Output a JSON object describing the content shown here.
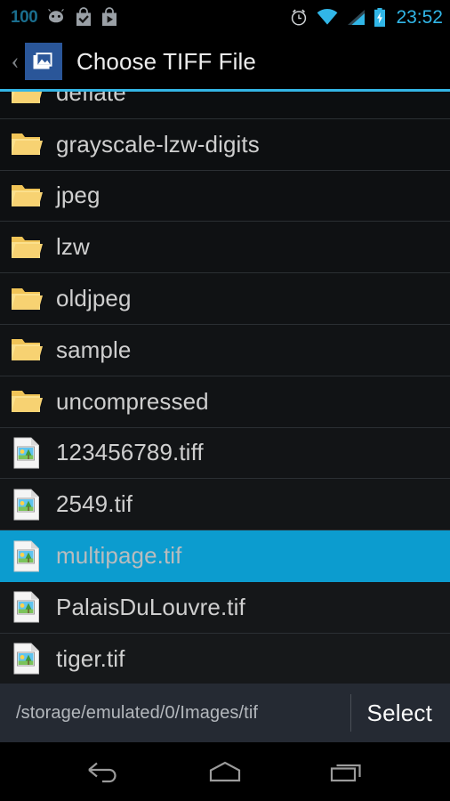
{
  "status_bar": {
    "battery_percent": "100",
    "battery_color": "#1a6e8e",
    "clock": "23:52",
    "clock_color": "#31b6e7",
    "left_icons": [
      "android-head-icon",
      "app-checked-icon",
      "play-store-icon"
    ],
    "right_icons": [
      "alarm-clock-icon",
      "wifi-icon",
      "cellular-signal-icon",
      "battery-charging-icon"
    ]
  },
  "title_bar": {
    "back_label": "‹",
    "app_icon": "gallery-image-icon",
    "app_icon_bg": "#2a5699",
    "title": "Choose TIFF File",
    "accent_rule_color": "#33b5e5"
  },
  "file_list": {
    "selected_index": 9,
    "rows": [
      {
        "name": "deflate",
        "type": "folder",
        "selected": false,
        "clipped": true
      },
      {
        "name": "grayscale-lzw-digits",
        "type": "folder",
        "selected": false,
        "clipped": false
      },
      {
        "name": "jpeg",
        "type": "folder",
        "selected": false,
        "clipped": false
      },
      {
        "name": "lzw",
        "type": "folder",
        "selected": false,
        "clipped": false
      },
      {
        "name": "oldjpeg",
        "type": "folder",
        "selected": false,
        "clipped": false
      },
      {
        "name": "sample",
        "type": "folder",
        "selected": false,
        "clipped": false
      },
      {
        "name": "uncompressed",
        "type": "folder",
        "selected": false,
        "clipped": false
      },
      {
        "name": "123456789.tiff",
        "type": "file",
        "selected": false,
        "clipped": false
      },
      {
        "name": "2549.tif",
        "type": "file",
        "selected": false,
        "clipped": false
      },
      {
        "name": "multipage.tif",
        "type": "file",
        "selected": true,
        "clipped": false
      },
      {
        "name": "PalaisDuLouvre.tif",
        "type": "file",
        "selected": false,
        "clipped": false
      },
      {
        "name": "tiger.tif",
        "type": "file",
        "selected": false,
        "clipped": false
      }
    ],
    "folder_icon": "folder-icon",
    "file_icon": "image-file-icon",
    "selection_color": "#0c9ccf"
  },
  "bottom_bar": {
    "path": "/storage/emulated/0/Images/tif",
    "select_label": "Select"
  },
  "nav_bar": {
    "buttons": [
      "back-icon",
      "home-icon",
      "recents-icon"
    ]
  }
}
